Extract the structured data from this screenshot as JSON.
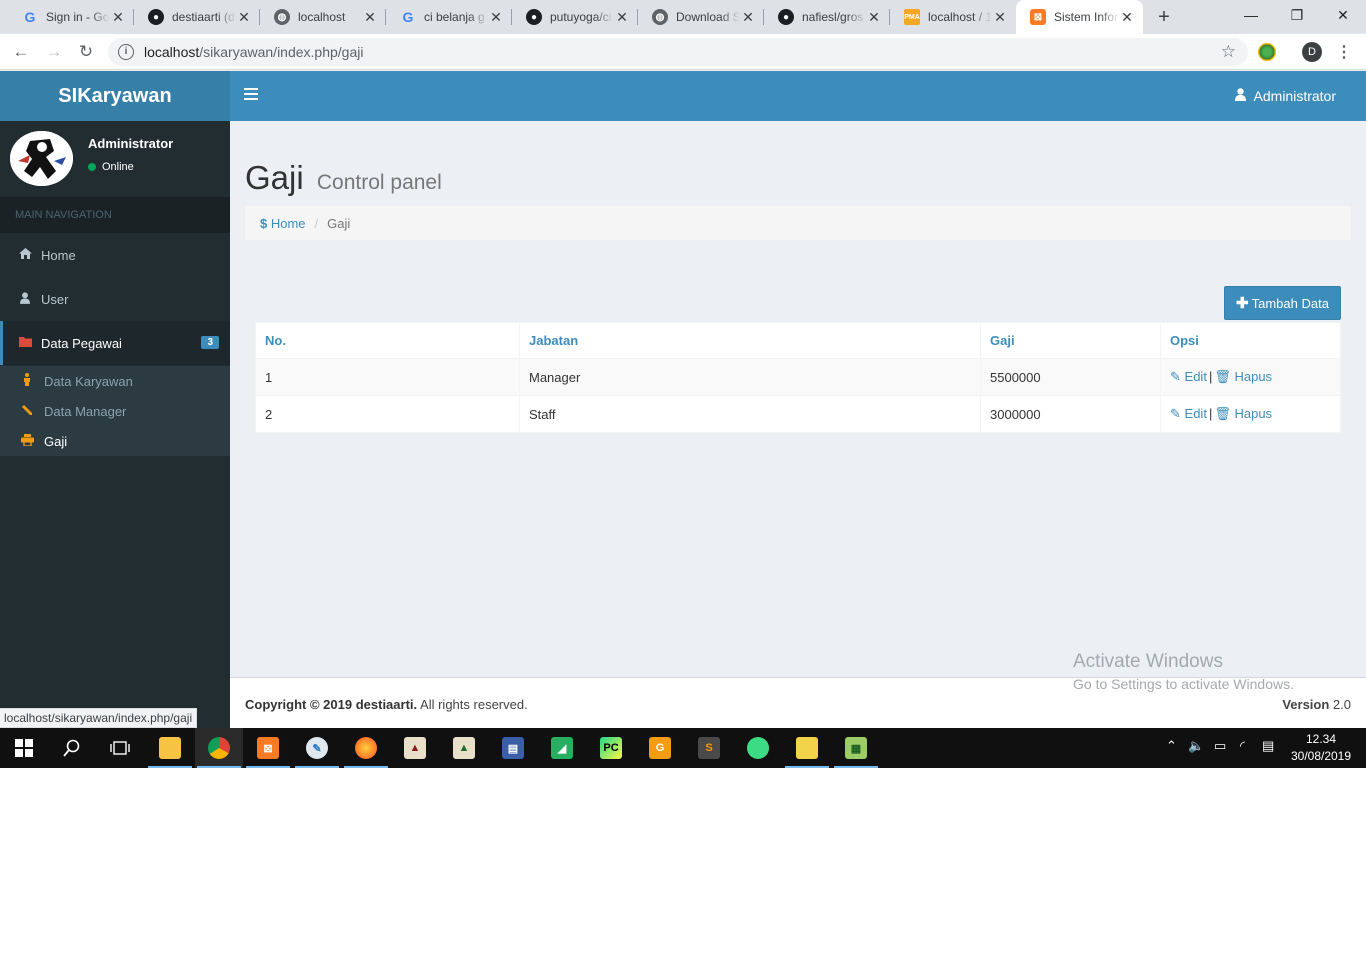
{
  "browser": {
    "tabs": [
      {
        "title": "Sign in - Google Accounts",
        "favicon": "google-icon"
      },
      {
        "title": "destiaarti (destiaarti)",
        "favicon": "github-icon"
      },
      {
        "title": "localhost",
        "favicon": "globe-icon"
      },
      {
        "title": "ci belanja g",
        "favicon": "google-icon"
      },
      {
        "title": "putuyoga/ci",
        "favicon": "github-icon"
      },
      {
        "title": "Download S",
        "favicon": "globe-icon"
      },
      {
        "title": "nafiesl/gros",
        "favicon": "github-icon"
      },
      {
        "title": "localhost / 1",
        "favicon": "phpmyadmin-icon"
      },
      {
        "title": "Sistem Infor",
        "favicon": "xampp-icon",
        "active": true
      }
    ],
    "url_host": "localhost",
    "url_path": "/sikaryawan/index.php/gaji",
    "profile_initial": "D",
    "status_url": "localhost/sikaryawan/index.php/gaji"
  },
  "app": {
    "brand": "SIKaryawan",
    "topnav_user": "Administrator"
  },
  "sidebar": {
    "user_name": "Administrator",
    "user_status": "Online",
    "nav_header": "MAIN NAVIGATION",
    "items": [
      {
        "label": "Home",
        "icon": "home-icon"
      },
      {
        "label": "User",
        "icon": "user-icon"
      },
      {
        "label": "Data Pegawai",
        "icon": "folder-icon",
        "badge": "3"
      }
    ],
    "subitems": [
      {
        "label": "Data Karyawan",
        "icon": "person-icon"
      },
      {
        "label": "Data Manager",
        "icon": "pencil-icon"
      },
      {
        "label": "Gaji",
        "icon": "print-icon",
        "active": true
      }
    ]
  },
  "page": {
    "title": "Gaji",
    "subtitle": "Control panel",
    "breadcrumb_home": "Home",
    "breadcrumb_current": "Gaji",
    "add_button": "Tambah Data"
  },
  "table": {
    "headers": [
      "No.",
      "Jabatan",
      "Gaji",
      "Opsi"
    ],
    "rows": [
      {
        "no": "1",
        "jabatan": "Manager",
        "gaji": "5500000"
      },
      {
        "no": "2",
        "jabatan": "Staff",
        "gaji": "3000000"
      }
    ],
    "edit_label": "Edit",
    "delete_label": "Hapus",
    "separator": "|"
  },
  "footer": {
    "copyright_bold": "Copyright © 2019 destiaarti.",
    "copyright_rest": "All rights reserved.",
    "version_label": "Version",
    "version_value": "2.0"
  },
  "watermark": {
    "line1": "Activate Windows",
    "line2": "Go to Settings to activate Windows."
  },
  "taskbar": {
    "time": "12.34",
    "date": "30/08/2019"
  },
  "colors": {
    "primary": "#3c8dbc",
    "primary_dark": "#367fa9",
    "sidebar": "#222d32",
    "online": "#00a65a"
  }
}
